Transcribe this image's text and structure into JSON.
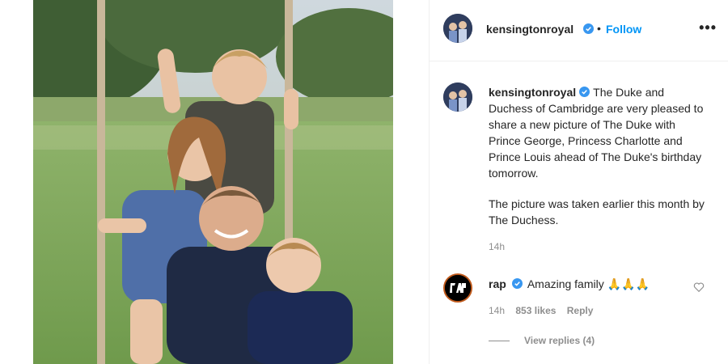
{
  "post": {
    "photo_icon": "family-photo",
    "photo_alt": "Family on a rope swing in a field"
  },
  "header": {
    "username": "kensingtonroyal",
    "separator": "•",
    "follow_label": "Follow",
    "more_label": "•••"
  },
  "caption": {
    "username": "kensingtonroyal",
    "paragraph1": "The Duke and Duchess of Cambridge are very pleased to share a new picture of The Duke with Prince George, Princess Charlotte and Prince Louis ahead of The Duke's birthday tomorrow.",
    "paragraph2": "The picture was taken earlier this month by The Duchess.",
    "time": "14h"
  },
  "comment": {
    "username": "rap",
    "text": "Amazing family",
    "emoji": "🙏🙏🙏",
    "time": "14h",
    "likes": "853 likes",
    "reply_label": "Reply",
    "view_replies": "View replies (4)"
  },
  "colors": {
    "accent": "#0095f6",
    "verified": "#3897f0",
    "muted": "#8e8e8e"
  }
}
